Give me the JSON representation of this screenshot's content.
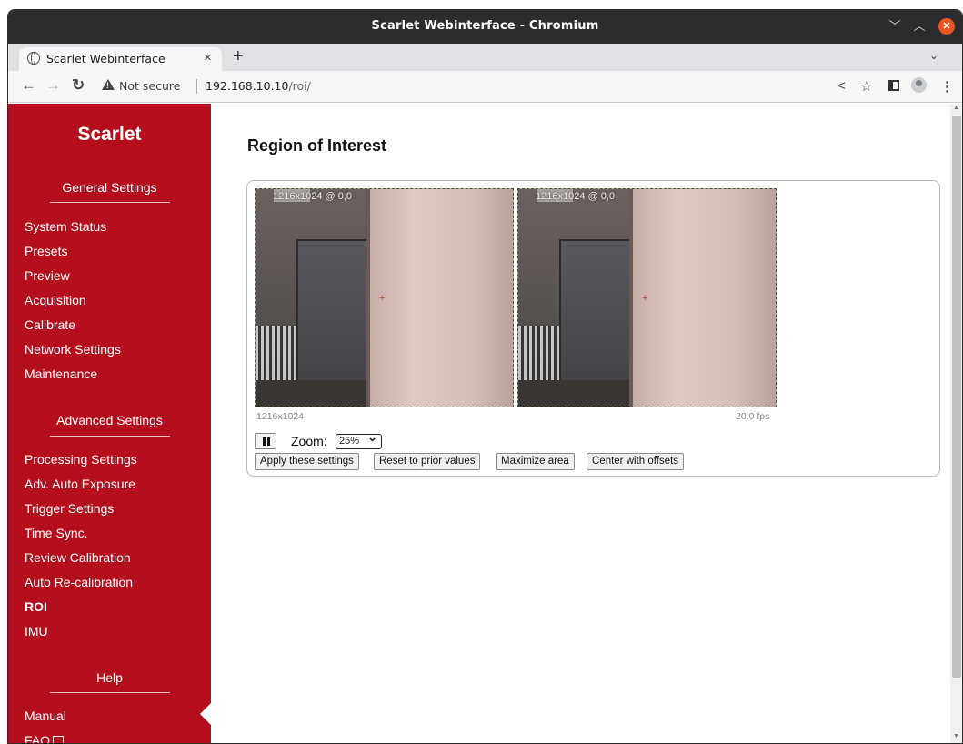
{
  "window": {
    "title": "Scarlet Webinterface - Chromium"
  },
  "tab": {
    "label": "Scarlet Webinterface",
    "close": "×",
    "new": "+"
  },
  "address": {
    "security": "Not secure",
    "host": "192.168.10.10",
    "path": "/roi/"
  },
  "sidebar": {
    "brand": "Scarlet",
    "general_title": "General Settings",
    "general_items": [
      "System Status",
      "Presets",
      "Preview",
      "Acquisition",
      "Calibrate",
      "Network Settings",
      "Maintenance"
    ],
    "advanced_title": "Advanced Settings",
    "advanced_items": [
      "Processing Settings",
      "Adv. Auto Exposure",
      "Trigger Settings",
      "Time Sync.",
      "Review Calibration",
      "Auto Re-calibration",
      "ROI",
      "IMU"
    ],
    "help_title": "Help",
    "help_items": [
      "Manual",
      "FAQ"
    ],
    "active": "ROI",
    "color": "#b50f1e"
  },
  "main": {
    "title": "Region of Interest",
    "cameras": [
      {
        "overlay": "1216x1024 @ 0,0"
      },
      {
        "overlay": "1216x1024 @ 0,0"
      }
    ],
    "resolution": "1216x1024",
    "fps": "20.0 fps",
    "zoom_label": "Zoom:",
    "zoom_value": "25%",
    "buttons": {
      "apply": "Apply these settings",
      "reset": "Reset to prior values",
      "maximize": "Maximize area",
      "center": "Center with offsets"
    }
  }
}
